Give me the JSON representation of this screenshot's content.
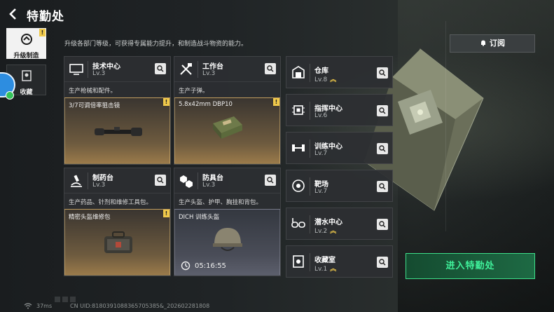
{
  "header": {
    "title": "特勤处",
    "subtitle": "升级各部门等级，可获得专属能力提升，和制造战斗物资的能力。"
  },
  "tabs": [
    {
      "label": "升级制造",
      "active": true,
      "alert": "!"
    },
    {
      "label": "收藏",
      "active": false
    }
  ],
  "subscribe_label": "订阅",
  "enter_label": "进入特勤处",
  "cards": [
    {
      "name": "技术中心",
      "level": "Lv.3",
      "icon": "monitor-icon",
      "desc": "生产枪械和配件。",
      "product": "3/7可调倍率狙击镜",
      "alert": "!"
    },
    {
      "name": "工作台",
      "level": "Lv.3",
      "icon": "tools-icon",
      "desc": "生产子弹。",
      "product": "5.8x42mm DBP10",
      "alert": "!"
    },
    {
      "name": "制药台",
      "level": "Lv.3",
      "icon": "microscope-icon",
      "desc": "生产药品、针剂和维修工具包。",
      "product": "精密头盔维修包",
      "alert": "!"
    },
    {
      "name": "防具台",
      "level": "Lv.3",
      "icon": "armor-parts-icon",
      "desc": "生产头盔、护甲、胸挂和背包。",
      "product": "DICH 训练头盔",
      "timer": "05:16:55"
    }
  ],
  "list": [
    {
      "name": "仓库",
      "level": "Lv.8",
      "icon": "warehouse-icon",
      "upgrade": true
    },
    {
      "name": "指挥中心",
      "level": "Lv.6",
      "icon": "chip-icon",
      "upgrade": false
    },
    {
      "name": "训练中心",
      "level": "Lv.7",
      "icon": "dumbbell-icon",
      "upgrade": false
    },
    {
      "name": "靶场",
      "level": "Lv.7",
      "icon": "target-icon",
      "upgrade": false
    },
    {
      "name": "潜水中心",
      "level": "Lv.2",
      "icon": "diving-mask-icon",
      "upgrade": true
    },
    {
      "name": "收藏室",
      "level": "Lv.1",
      "icon": "collection-icon",
      "upgrade": true
    }
  ],
  "status": {
    "ping": "37ms",
    "uid": "CN UID:8180391088365705385&_202602281808"
  },
  "colors": {
    "accent_green": "#3ff09a",
    "alert_yellow": "#f0c94a",
    "upgrade_arrow": "#f0c94a"
  }
}
